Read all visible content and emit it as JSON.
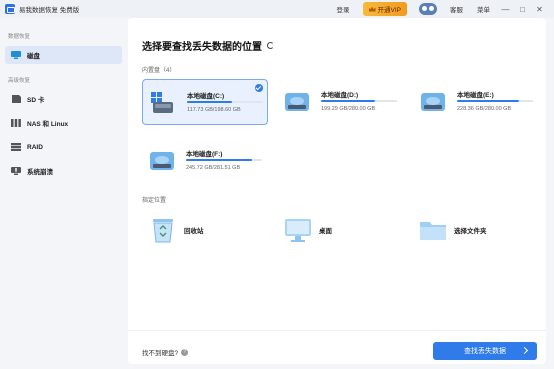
{
  "app": {
    "title": "易我数据恢复 免费版"
  },
  "titlebar": {
    "login": "登录",
    "vip": "开通VIP",
    "support": "客服",
    "menu": "菜单",
    "minimize": "—",
    "maximize": "□",
    "close": "✕"
  },
  "sidebar": {
    "section_recovery": "数据恢复",
    "section_other": "高级恢复",
    "items": [
      {
        "label": "磁盘"
      },
      {
        "label": "SD 卡"
      },
      {
        "label": "NAS 和 Linux"
      },
      {
        "label": "RAID"
      },
      {
        "label": "系统崩溃"
      }
    ]
  },
  "main": {
    "heading": "选择要查找丢失数据的位置",
    "builtin_label": "内置盘（4）",
    "disks": [
      {
        "name": "本地磁盘(C:)",
        "size": "117.73 GB/198.60 GB",
        "used_fraction": 0.59,
        "selected": true
      },
      {
        "name": "本地磁盘(D:)",
        "size": "199.29 GB/280.00 GB",
        "used_fraction": 0.71
      },
      {
        "name": "本地磁盘(E:)",
        "size": "228.36 GB/280.00 GB",
        "used_fraction": 0.81
      },
      {
        "name": "本地磁盘(F:)",
        "size": "245.72 GB/281.51 GB",
        "used_fraction": 0.87
      }
    ],
    "locations_label": "指定位置",
    "locations": [
      {
        "label": "回收站"
      },
      {
        "label": "桌面"
      },
      {
        "label": "选择文件夹"
      }
    ],
    "not_found": "找不到硬盘?",
    "help": "?",
    "scan_button": "查找丢失数据"
  },
  "colors": {
    "accent": "#2f7be9",
    "vip": "#f5a623",
    "selected_bg": "#e8f1fd"
  }
}
